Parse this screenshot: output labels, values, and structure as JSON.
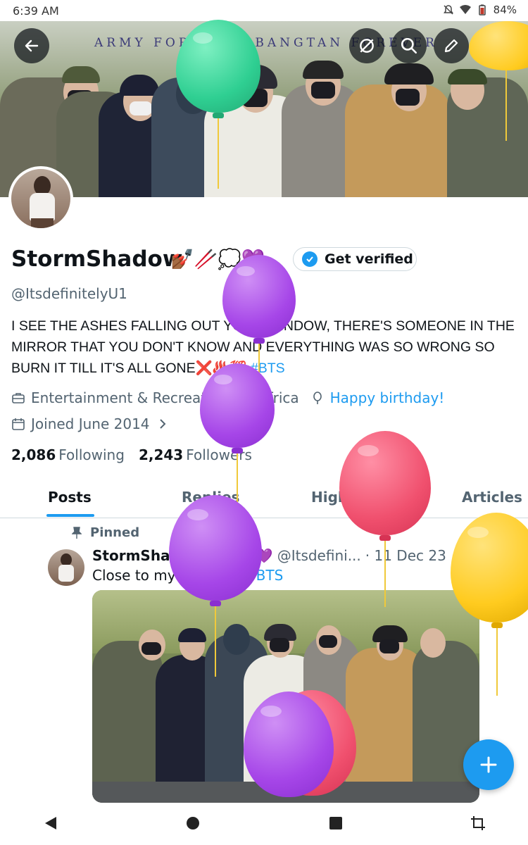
{
  "status_bar": {
    "time": "6:39 AM",
    "battery": "84%"
  },
  "banner": {
    "caption": "ARMY FOREVER, BANGTAN FOREVER"
  },
  "profile": {
    "display_name": "StormShadow",
    "name_emoji": "💅🏾🥢💭💜",
    "get_verified_label": "Get verified",
    "handle": "@ItsdefinitelyU1",
    "bio_text": "I SEE THE ASHES FALLING OUT YOUR WINDOW, THERE'S SOMEONE IN THE MIRROR THAT YOU DON'T KNOW AND EVERYTHING WAS SO WRONG SO BURN IT TILL IT'S ALL GONE❌♨️💯 ",
    "bio_hashtag": "#BTS",
    "category": "Entertainment & Recreation",
    "location": "Africa",
    "birthday_link": "Happy birthday!",
    "joined": "Joined June 2014",
    "following_count": "2,086",
    "following_label": "Following",
    "followers_count": "2,243",
    "followers_label": "Followers"
  },
  "tabs": [
    {
      "label": "Posts"
    },
    {
      "label": "Replies"
    },
    {
      "label": "Highlights"
    },
    {
      "label": "Articles"
    }
  ],
  "pinned_post": {
    "pinned_label": "Pinned",
    "author_name": "StormShadow💅🏾🥢💭💜",
    "author_handle": "@Itsdefini...",
    "date": "· 11 Dec 23",
    "text": "Close to my heart 💜 ",
    "hashtag": "#BTS"
  },
  "icons": {
    "back": "back-arrow-icon",
    "search": "search-icon",
    "edit": "edit-icon",
    "more": "more-icon",
    "fab": "compose-plus-icon"
  },
  "colors": {
    "accent": "#1d9bf0",
    "text_primary": "#0f1419",
    "text_secondary": "#536471",
    "balloon_green": "#3fd9a0",
    "balloon_purple": "#a646e8",
    "balloon_pink": "#f0506e",
    "balloon_yellow": "#ffd12a"
  }
}
